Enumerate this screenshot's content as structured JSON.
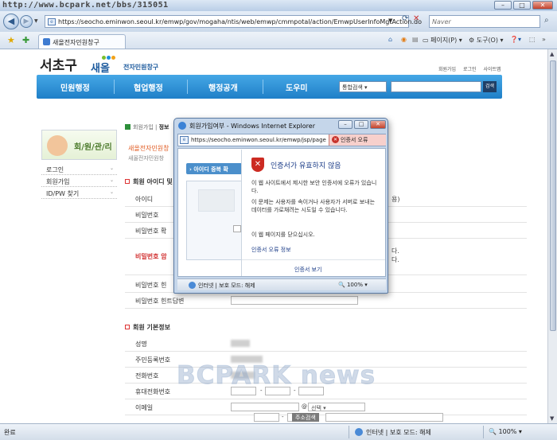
{
  "browser": {
    "watermark_url": "http://www.bcpark.net/bbs/315051",
    "address_url": "https://seocho.eminwon.seoul.kr/emwp/gov/mogaha/ntis/web/emwp/cmmpotal/action/EmwpUserInfoMgtAction.do",
    "search_placeholder": "Naver",
    "tab_label": "새올전자민원창구",
    "page_menu": "페이지(P)",
    "tools_menu": "도구(O)",
    "status_text": "완료",
    "zone_text": "인터넷 | 보호 모드: 해제",
    "zoom": "100%"
  },
  "site": {
    "logo_gu": "서초구",
    "logo_main": "새올",
    "logo_sub": "전자민원창구",
    "logo_dot_colors": [
      "#7bbf2d",
      "#1d8fdc",
      "#f2a21a"
    ],
    "top_links": [
      "회원가입",
      "로그인",
      "사이트맵"
    ],
    "gnb": [
      "민원행정",
      "협업행정",
      "행정공개",
      "도우미"
    ],
    "search_select": "통합검색",
    "search_button": "검색"
  },
  "sidebar": {
    "title": "회/원/관/리",
    "items": [
      "로그인",
      "회원가입",
      "ID/PW 찾기"
    ]
  },
  "content": {
    "breadcrumb_home": "회원가입",
    "breadcrumb_current": "정보",
    "greet1": "새올전자민원창",
    "greet2": "새올전자민원창",
    "section_id": "회원 아이디 및 비",
    "section_basic": "회원 기본정보",
    "rows_top": [
      {
        "label": "아이디",
        "note": "용)",
        "red": false
      },
      {
        "label": "비밀번호",
        "note": "",
        "red": false
      },
      {
        "label": "비밀번호 확",
        "note": "",
        "red": false
      },
      {
        "label": "비밀번호 암",
        "note": "다.",
        "red": true
      },
      {
        "label": "비밀번호 힌",
        "note": "",
        "red": false
      },
      {
        "label": "비밀번호 힌트답변",
        "note": "",
        "red": false
      }
    ],
    "rows_basic": [
      "성명",
      "주민등록번호",
      "전화번호",
      "휴대전화번호",
      "이메일",
      ""
    ],
    "email_at": "@",
    "email_select": "선택",
    "address_button": "주소검색"
  },
  "popup": {
    "title": "회원가입여부 - Windows Internet Explorer",
    "url": "https://seocho.eminwon.seoul.kr/emwp/jsp/page",
    "cert_error_badge": "인증서 오류",
    "tab_label": "아이디 중복 확",
    "cert_title": "인증서가 유효하지 않음",
    "cert_p1": "이 웹 사이트에서 제시한 보안 인증서에 오류가 있습니다.",
    "cert_p2": "이 문제는 사용자를 속이거나 사용자가 서버로 보내는 데이터를 가로채려는 시도일 수 있습니다.",
    "cert_p3": "이 웹 페이지를 닫으십시오.",
    "cert_link": "인증서 오류 정보",
    "cert_view": "인증서 보기",
    "status_text": "인터넷 | 보호 모드: 해제",
    "zoom": "100%"
  },
  "watermark": "BCPARK news"
}
